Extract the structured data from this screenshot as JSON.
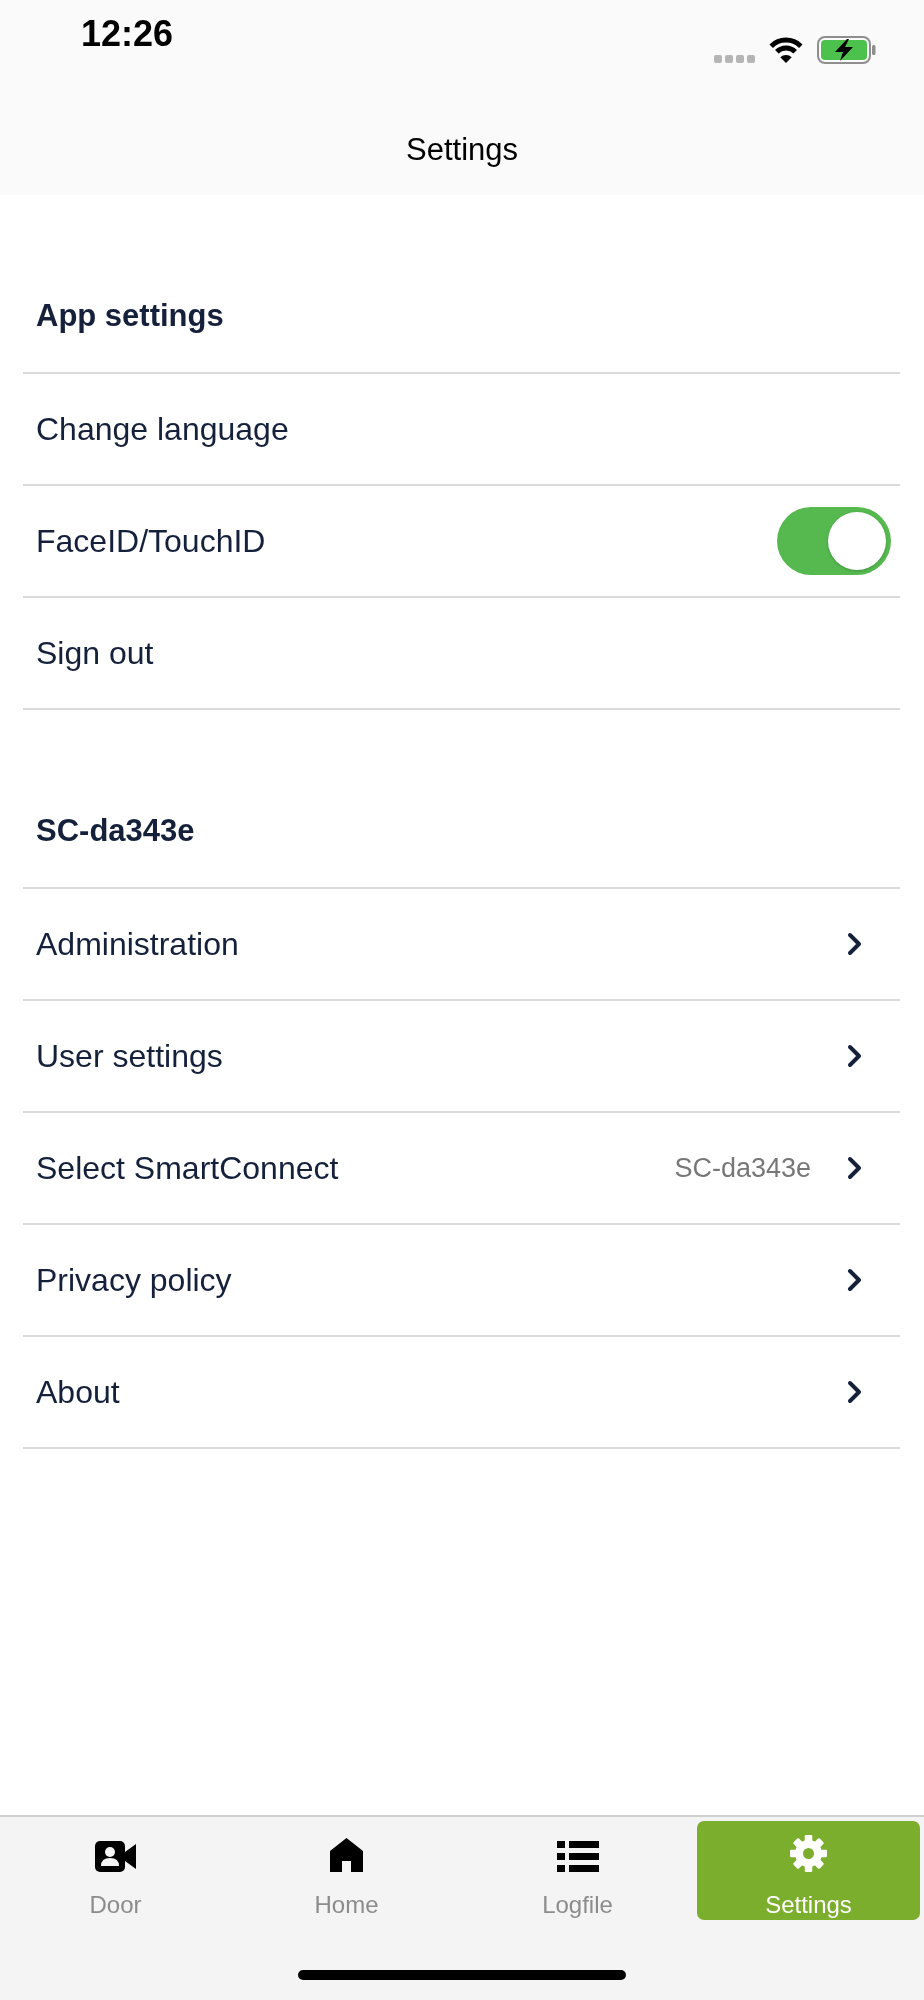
{
  "status_bar": {
    "time": "12:26"
  },
  "header": {
    "title": "Settings"
  },
  "sections": [
    {
      "title": "App settings",
      "rows": [
        {
          "kind": "plain",
          "label": "Change language"
        },
        {
          "kind": "toggle",
          "label": "FaceID/TouchID",
          "on": true
        },
        {
          "kind": "plain",
          "label": "Sign out"
        }
      ]
    },
    {
      "title": "SC-da343e",
      "rows": [
        {
          "kind": "link",
          "label": "Administration"
        },
        {
          "kind": "link",
          "label": "User settings"
        },
        {
          "kind": "link",
          "label": "Select SmartConnect",
          "value": "SC-da343e"
        },
        {
          "kind": "link",
          "label": "Privacy policy"
        },
        {
          "kind": "link",
          "label": "About"
        }
      ]
    }
  ],
  "tab_bar": {
    "tabs": [
      {
        "label": "Door",
        "selected": false
      },
      {
        "label": "Home",
        "selected": false
      },
      {
        "label": "Logfile",
        "selected": false
      },
      {
        "label": "Settings",
        "selected": true
      }
    ]
  }
}
